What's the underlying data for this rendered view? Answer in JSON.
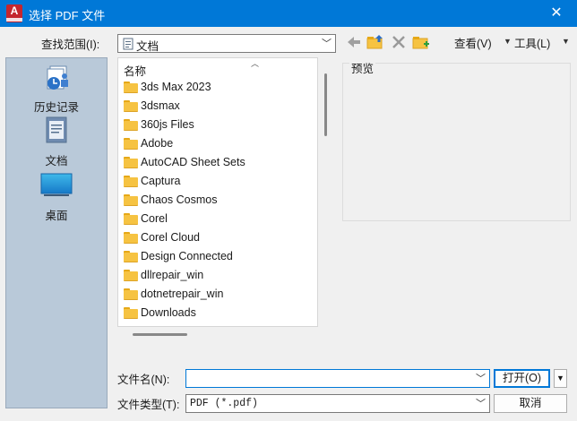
{
  "window": {
    "title": "选择 PDF 文件",
    "close_glyph": "✕",
    "app_icon_letter": "A"
  },
  "lookin": {
    "label": "查找范围(I):",
    "value": "文档"
  },
  "toolbar": {
    "icons": [
      "back-arrow-icon",
      "folder-up-icon",
      "delete-icon",
      "new-folder-icon"
    ],
    "view_label": "查看(V)",
    "tools_label": "工具(L)"
  },
  "places": [
    {
      "id": "history",
      "label": "历史记录",
      "icon": "history-icon"
    },
    {
      "id": "documents",
      "label": "文档",
      "icon": "documents-icon"
    },
    {
      "id": "desktop",
      "label": "桌面",
      "icon": "desktop-icon"
    }
  ],
  "filelist": {
    "header": "名称",
    "items": [
      "3ds Max 2023",
      "3dsmax",
      "360js Files",
      "Adobe",
      "AutoCAD Sheet Sets",
      "Captura",
      "Chaos Cosmos",
      "Corel",
      "Corel Cloud",
      "Design Connected",
      "dllrepair_win",
      "dotnetrepair_win",
      "Downloads"
    ]
  },
  "preview": {
    "label": "预览"
  },
  "filename": {
    "label": "文件名(N):",
    "value": ""
  },
  "filetype": {
    "label": "文件类型(T):",
    "value": "PDF (*.pdf)"
  },
  "buttons": {
    "open": "打开(O)",
    "cancel": "取消"
  },
  "colors": {
    "titlebar": "#0078d7",
    "places_bg": "#b9c9d9",
    "folder": "#f6c342",
    "accent": "#0078d7"
  }
}
